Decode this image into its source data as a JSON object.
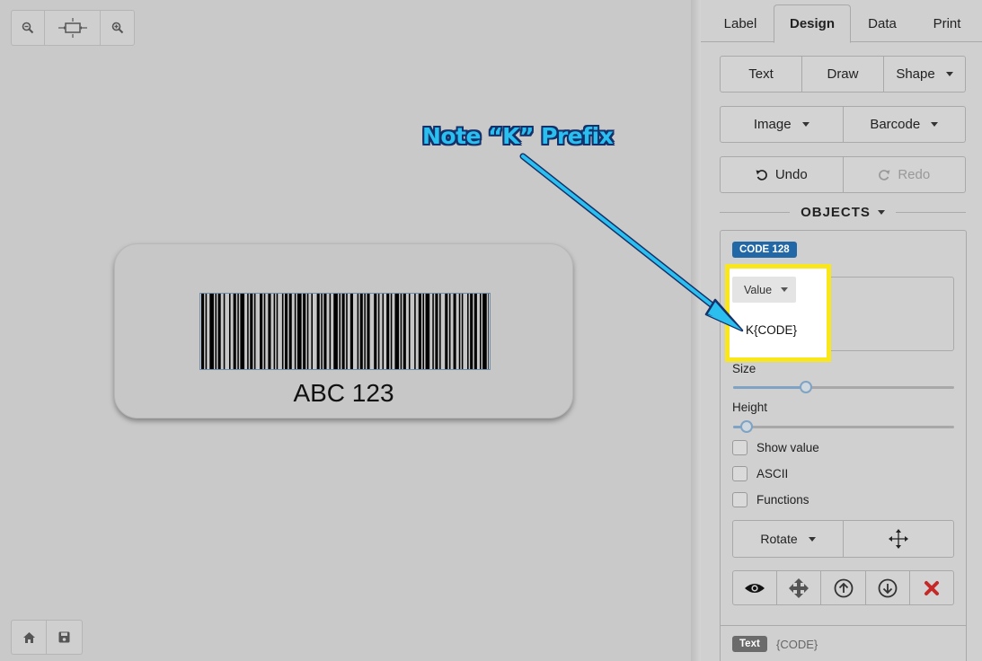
{
  "canvas": {
    "zoom_tools": [
      {
        "icon": "zoom-out-icon"
      },
      {
        "icon": "fit-to-screen-icon"
      },
      {
        "icon": "zoom-in-icon"
      }
    ],
    "file_tools": [
      {
        "icon": "home-icon"
      },
      {
        "icon": "save-icon"
      }
    ],
    "label": {
      "barcode_text": "ABC 123"
    },
    "annotation": {
      "text": "Note “K” Prefix",
      "color": "#2bbff0"
    }
  },
  "panel": {
    "tabs": [
      "Label",
      "Design",
      "Data",
      "Print"
    ],
    "active_tab": "Design",
    "design_buttons": {
      "text": "Text",
      "draw": "Draw",
      "shape": "Shape",
      "image": "Image",
      "barcode": "Barcode",
      "undo": "Undo",
      "redo": "Redo"
    },
    "objects_heading": "OBJECTS",
    "selected_object": {
      "type_badge": "CODE 128",
      "value_dropdown": "Value",
      "value": "K{CODE}",
      "size_label": "Size",
      "size_level": 0.33,
      "height_label": "Height",
      "height_level": 0.06,
      "checkboxes": [
        {
          "label": "Show value",
          "checked": false
        },
        {
          "label": "ASCII",
          "checked": false
        },
        {
          "label": "Functions",
          "checked": false
        }
      ],
      "rotate_label": "Rotate",
      "action_icons": [
        "eye-icon",
        "move-icon",
        "arrow-up-circle-icon",
        "arrow-down-circle-icon",
        "delete-icon"
      ]
    },
    "next_object": {
      "type_badge": "Text",
      "value": "{CODE}"
    }
  },
  "colors": {
    "badge_blue": "#2267a6",
    "highlight_yellow": "#f9e61b",
    "delete_red": "#c62828"
  }
}
